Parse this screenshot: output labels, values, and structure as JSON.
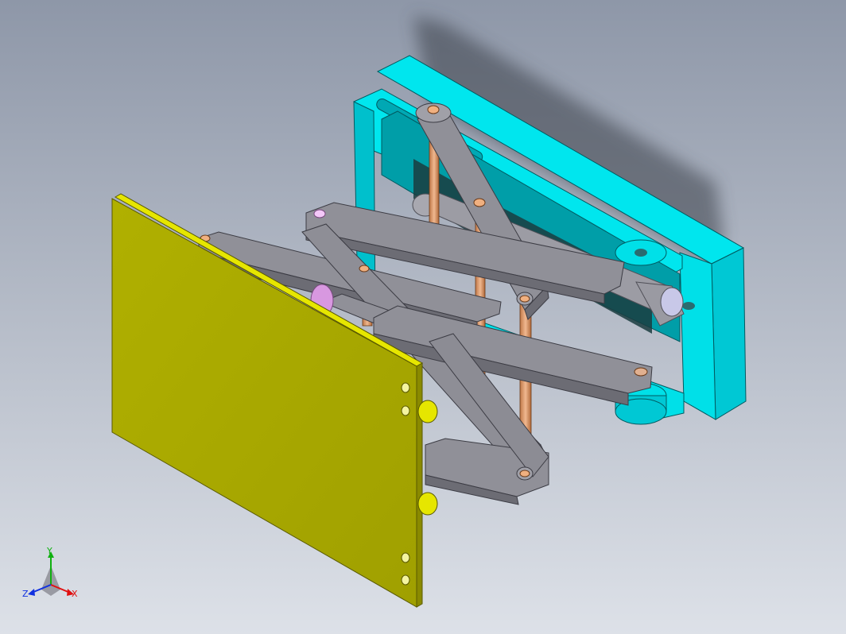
{
  "colors": {
    "background_top": "#8e97a8",
    "background_bottom": "#dde1e8",
    "plate": "#a8a800",
    "plate_edge": "#e6e600",
    "frame": "#00e0e8",
    "frame_dark": "#00b8c4",
    "link": "#8f8f96",
    "link_dark": "#66666d",
    "pin": "#e0a070",
    "cylinder": "#9a9aa2",
    "pink": "#d898e0"
  },
  "triad": {
    "x_label": "X",
    "y_label": "Y",
    "z_label": "Z",
    "x_color": "#e01010",
    "y_color": "#10b010",
    "z_color": "#1030e0"
  }
}
